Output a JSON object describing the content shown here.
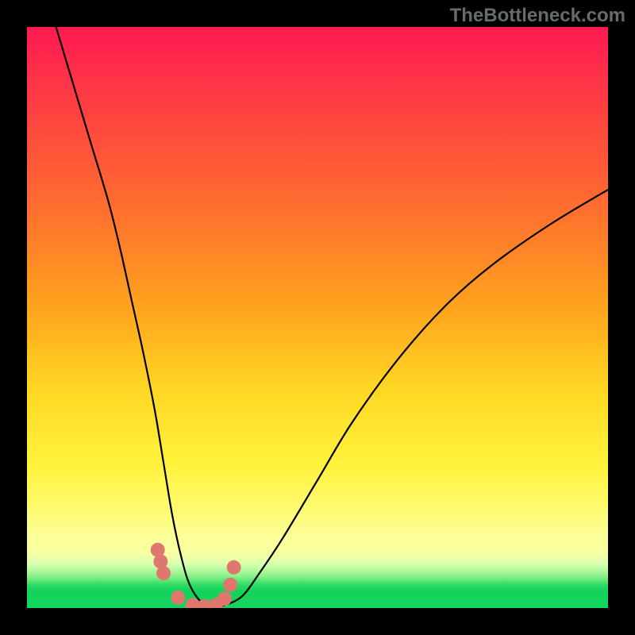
{
  "watermark": "TheBottleneck.com",
  "chart_data": {
    "type": "line",
    "title": "",
    "xlabel": "",
    "ylabel": "",
    "xlim": [
      0,
      100
    ],
    "ylim": [
      0,
      100
    ],
    "series": [
      {
        "name": "bottleneck-curve",
        "x": [
          5,
          8,
          11,
          14,
          16,
          18,
          20,
          22,
          23.5,
          25,
          26.5,
          28,
          30,
          32,
          34,
          37,
          40,
          44,
          50,
          56,
          64,
          72,
          80,
          90,
          100
        ],
        "values": [
          100,
          90,
          80,
          70,
          62,
          53,
          44,
          34,
          25,
          16,
          9,
          4,
          1,
          0,
          0.5,
          2,
          6,
          12,
          22,
          32,
          43,
          52,
          59,
          66,
          72
        ]
      }
    ],
    "markers": {
      "name": "highlighted-points",
      "x": [
        22.5,
        23.0,
        23.5,
        26.0,
        28.5,
        30.5,
        32.5,
        34.0,
        35.0,
        35.6
      ],
      "values": [
        10.0,
        8.0,
        6.0,
        1.8,
        0.5,
        0.3,
        0.5,
        1.6,
        4.0,
        7.0
      ]
    },
    "background_gradient": {
      "stops": [
        {
          "pos": 0.0,
          "color": "#ff1a52"
        },
        {
          "pos": 0.3,
          "color": "#ff6b30"
        },
        {
          "pos": 0.62,
          "color": "#ffd624"
        },
        {
          "pos": 0.88,
          "color": "#fcff9a"
        },
        {
          "pos": 0.96,
          "color": "#30dc64"
        },
        {
          "pos": 1.0,
          "color": "#13d45c"
        }
      ]
    }
  }
}
